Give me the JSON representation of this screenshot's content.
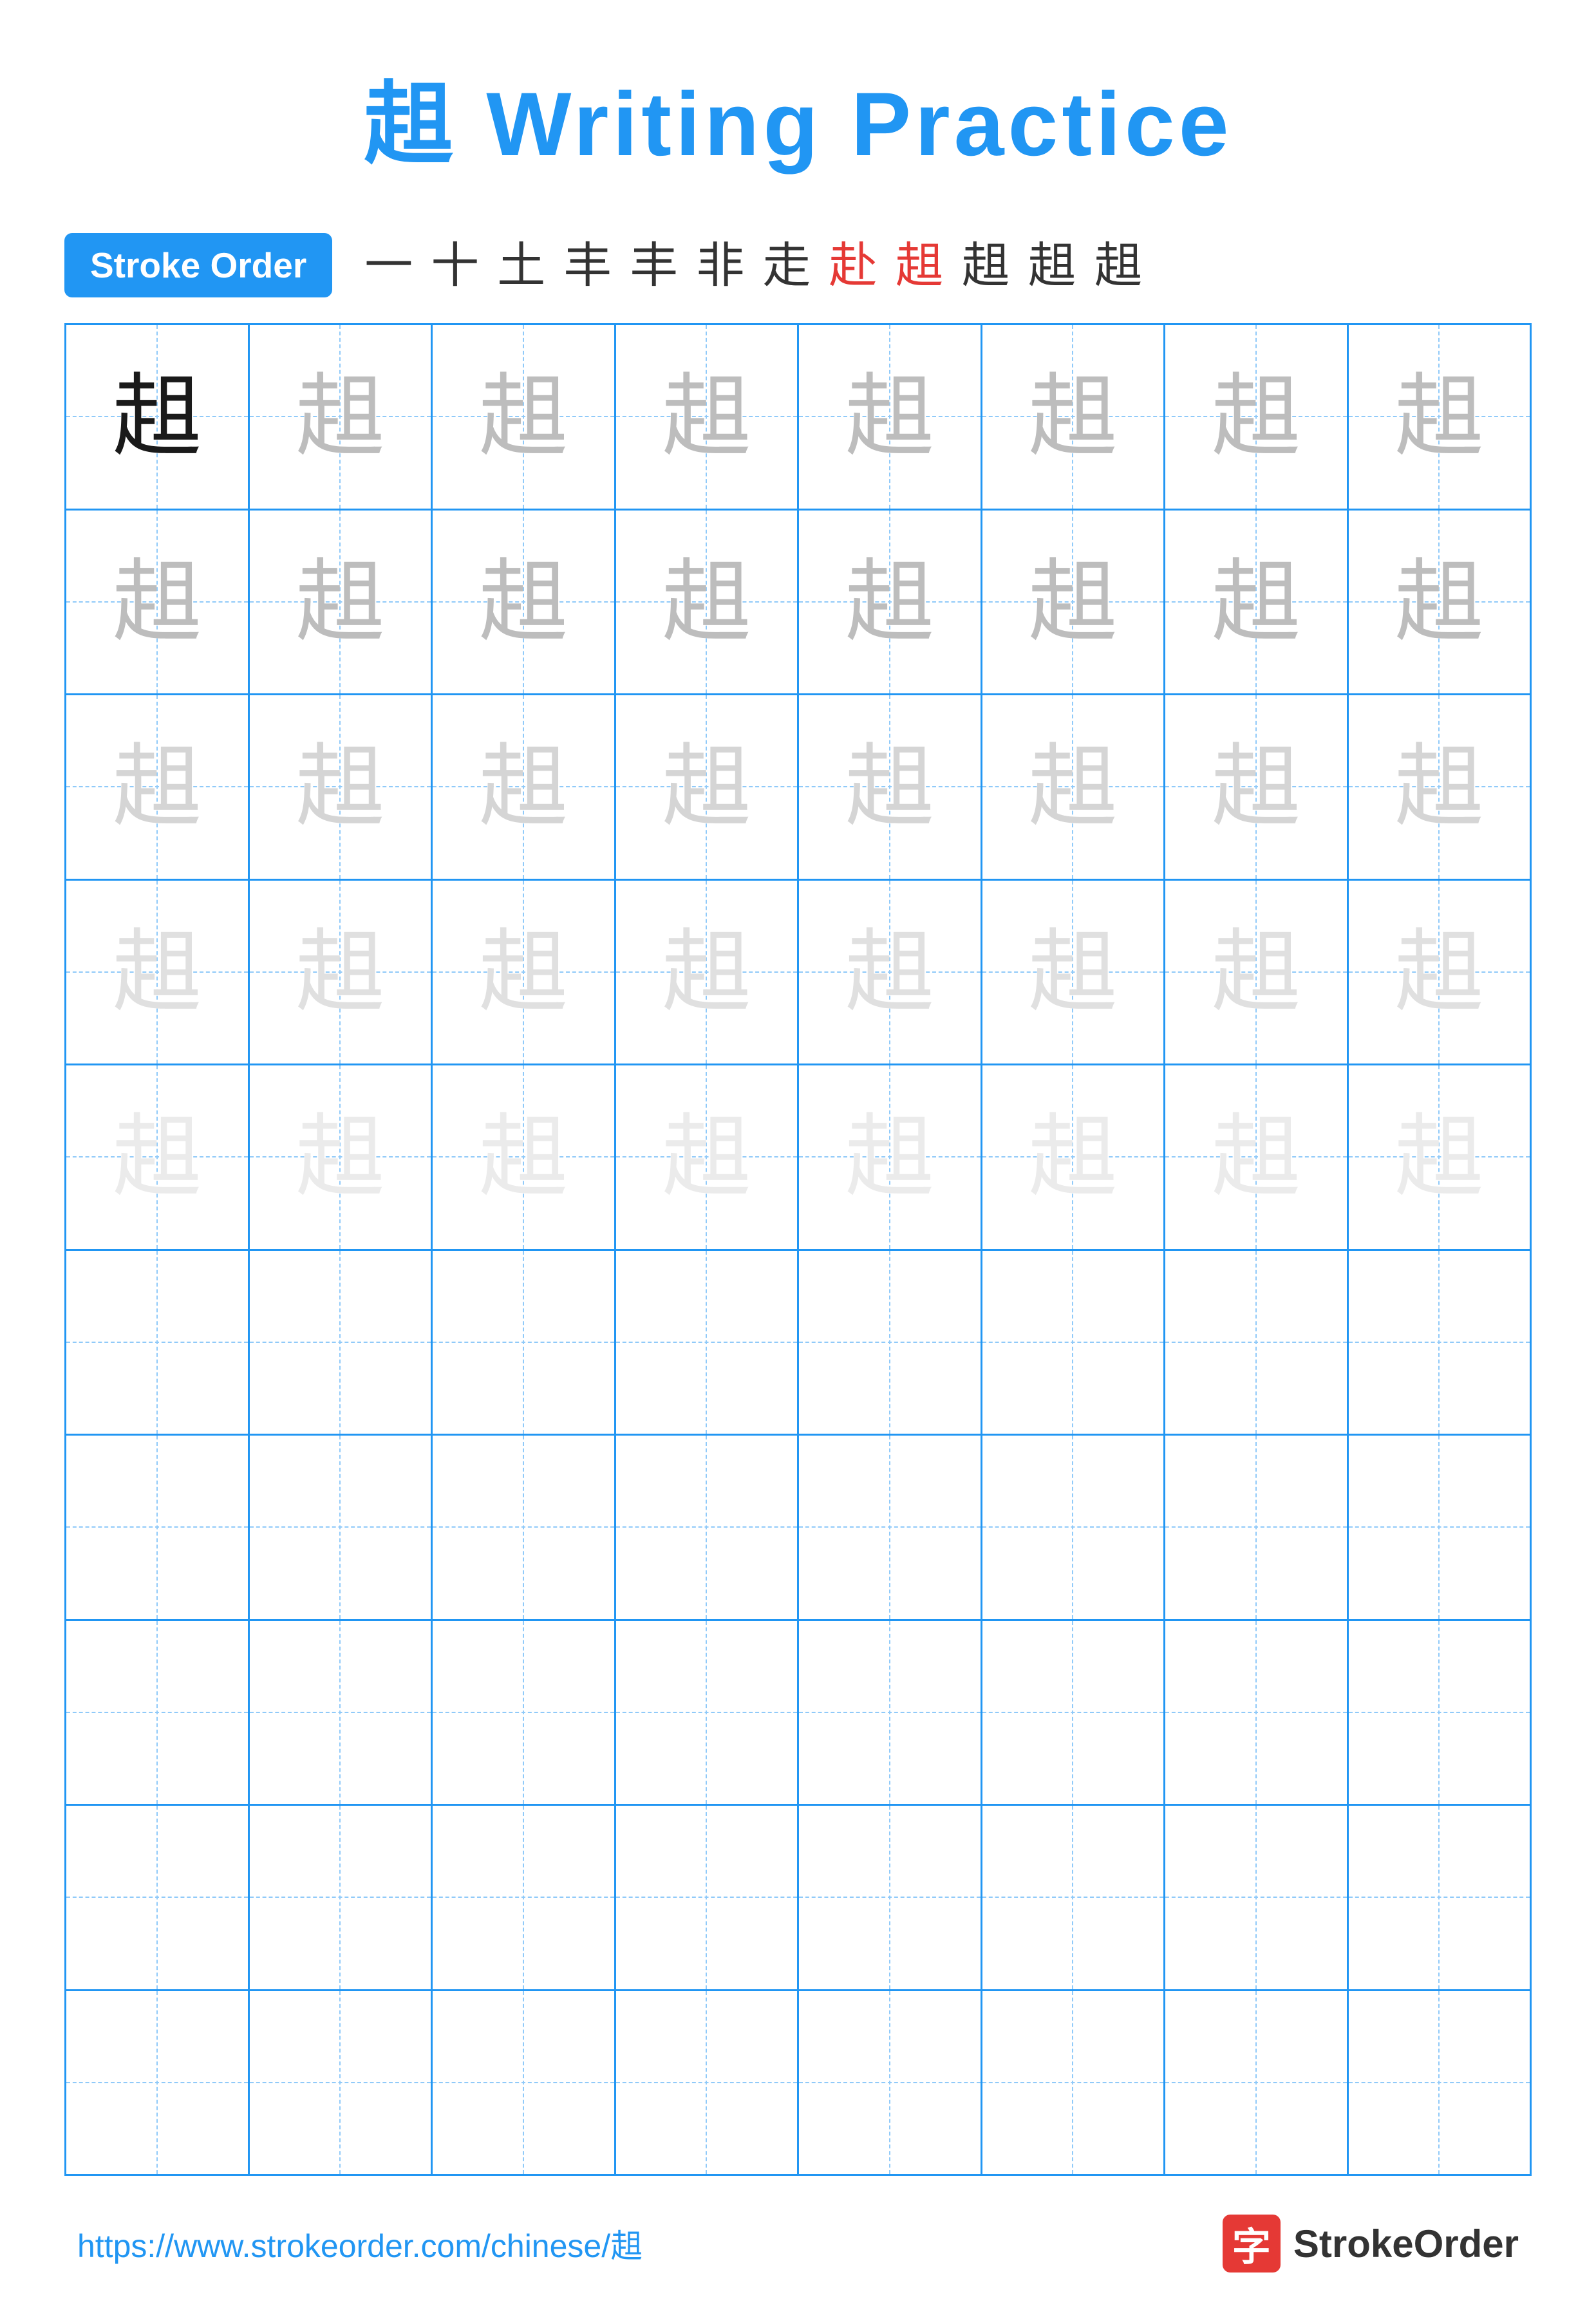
{
  "title": "趄 Writing Practice",
  "stroke_order": {
    "badge_label": "Stroke Order",
    "strokes": [
      "一",
      "十",
      "土",
      "丰",
      "丰",
      "非",
      "走",
      "赴",
      "趄",
      "趄",
      "趄",
      "趄"
    ],
    "red_index": 7
  },
  "practice_char": "趄",
  "grid": {
    "rows": 10,
    "cols": 8,
    "filled_rows": 5,
    "row_opacities": [
      "dark",
      "medium-gray",
      "light-gray",
      "very-light-gray",
      "ultra-light"
    ]
  },
  "footer": {
    "url": "https://www.strokeorder.com/chinese/趄",
    "logo_icon": "字",
    "logo_text": "StrokeOrder"
  }
}
